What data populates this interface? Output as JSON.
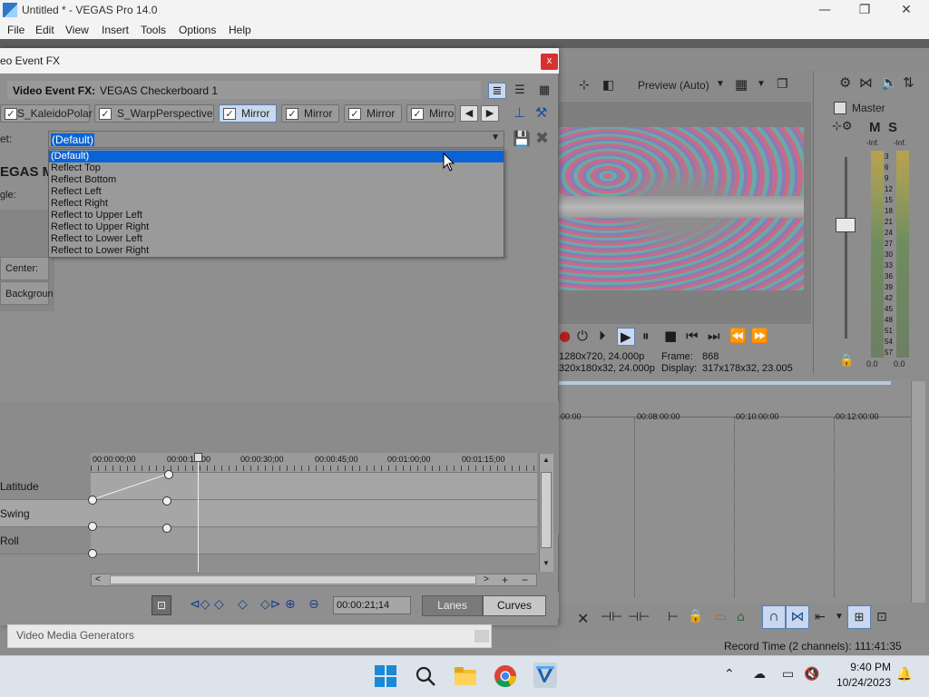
{
  "window": {
    "title": "Untitled * - VEGAS Pro 14.0",
    "min": "—",
    "max": "❐",
    "close": "✕"
  },
  "menu": [
    "File",
    "Edit",
    "View",
    "Insert",
    "Tools",
    "Options",
    "Help"
  ],
  "fx_dialog": {
    "title": "eo Event FX",
    "close_label": "x",
    "header_key": "Video Event FX:",
    "header_value": "VEGAS Checkerboard 1",
    "chain": [
      {
        "label": "S_KaleidoPolar",
        "checked": true,
        "selected": false
      },
      {
        "label": "S_WarpPerspective",
        "checked": true,
        "selected": false
      },
      {
        "label": "Mirror",
        "checked": true,
        "selected": true
      },
      {
        "label": "Mirror",
        "checked": true,
        "selected": false
      },
      {
        "label": "Mirror",
        "checked": true,
        "selected": false
      },
      {
        "label": "Mirro",
        "checked": true,
        "selected": false
      }
    ],
    "nav_prev": "◀",
    "nav_next": "▶",
    "preset_label": "et:",
    "preset_value": "(Default)",
    "preset_options": [
      "(Default)",
      "Reflect Top",
      "Reflect Bottom",
      "Reflect Left",
      "Reflect Right",
      "Reflect to Upper Left",
      "Reflect to Upper Right",
      "Reflect to Lower Left",
      "Reflect to Lower Right"
    ],
    "plugin_title": "EGAS M",
    "fields": [
      "gle:",
      "Center:",
      "Backgroun"
    ],
    "keyframes": {
      "ruler": [
        "00:00:00;00",
        "00:00:1",
        "00",
        "00:00:30;00",
        "00:00:45;00",
        "00:01:00;00",
        "00:01:15;00"
      ],
      "lanes": [
        "Latitude",
        "Swing",
        "Roll"
      ],
      "time": "00:00:21;14",
      "lanes_btn": "Lanes",
      "curves_btn": "Curves"
    }
  },
  "generators": {
    "label": "Video Media Generators"
  },
  "preview": {
    "mode": "Preview (Auto)",
    "project_info": "1280x720, 24.000p",
    "preview_info": "320x180x32, 24.000p",
    "frame_label": "Frame:",
    "frame_value": "868",
    "display_label": "Display:",
    "display_value": "317x178x32, 23.005"
  },
  "mixer": {
    "label": "Master",
    "m": "M",
    "s": "S",
    "inf_left": "-Inf.",
    "inf_right": "-Inf.",
    "scale": [
      "3",
      "6",
      "9",
      "12",
      "15",
      "18",
      "21",
      "24",
      "27",
      "30",
      "33",
      "36",
      "39",
      "42",
      "45",
      "48",
      "51",
      "54",
      "57"
    ],
    "zero_left": "0.0",
    "zero_right": "0.0"
  },
  "timeline": {
    "ticks": [
      "00:00",
      "00:08:00:00",
      "00:10:00:00",
      "00:12:00:00"
    ]
  },
  "status": {
    "record_time": "Record Time (2 channels): 111:41:35"
  },
  "taskbar": {
    "time": "9:40 PM",
    "date": "10/24/2023"
  }
}
